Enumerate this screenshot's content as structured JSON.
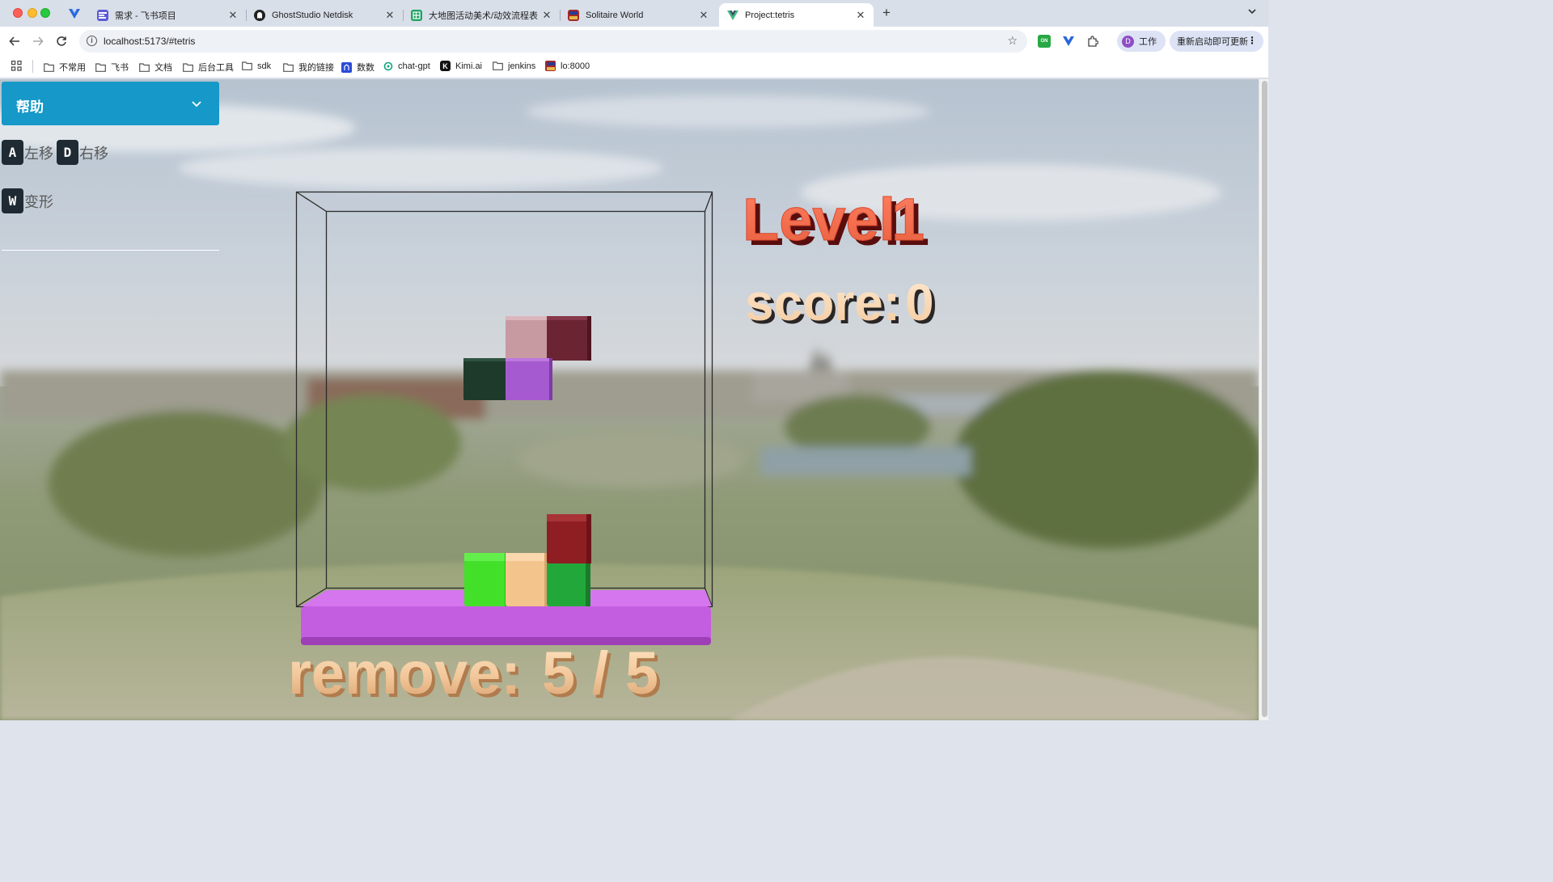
{
  "browser": {
    "tabs": [
      {
        "title": "需求 - 飞书项目",
        "icon": "feishu-project-icon"
      },
      {
        "title": "GhostStudio Netdisk",
        "icon": "ghost-icon"
      },
      {
        "title": "大地图活动美术/动效流程表 - G",
        "icon": "sheets-icon"
      },
      {
        "title": "Solitaire World",
        "icon": "solitaire-icon"
      },
      {
        "title": "Project:tetris",
        "icon": "vue-icon",
        "active": true
      }
    ],
    "url": "localhost:5173/#tetris",
    "profile_label": "工作",
    "profile_initial": "D",
    "update_label": "重新启动即可更新",
    "bookmarks": [
      "不常用",
      "飞书",
      "文档",
      "后台工具",
      "sdk",
      "我的链接",
      "数数",
      "chat-gpt",
      "Kimi.ai",
      "jenkins",
      "lo:8000"
    ]
  },
  "help": {
    "title": "帮助",
    "keys": [
      {
        "key": "A",
        "label": "左移"
      },
      {
        "key": "D",
        "label": "右移"
      },
      {
        "key": "W",
        "label": "变形"
      }
    ]
  },
  "game": {
    "level_label": "Level",
    "level": "1",
    "score_label": "score:",
    "score": "0",
    "remove_label": "remove:",
    "remove_progress": "5 / 5",
    "colors": {
      "platform": "#c45ee0",
      "pink": "#c79aa2",
      "maroon": "#6b2532",
      "dark_green": "#1e3a2a",
      "purple": "#a55ad0",
      "bright_green": "#43e02a",
      "peach": "#f4c48d",
      "green": "#22a83a",
      "red": "#8f1e22"
    }
  }
}
